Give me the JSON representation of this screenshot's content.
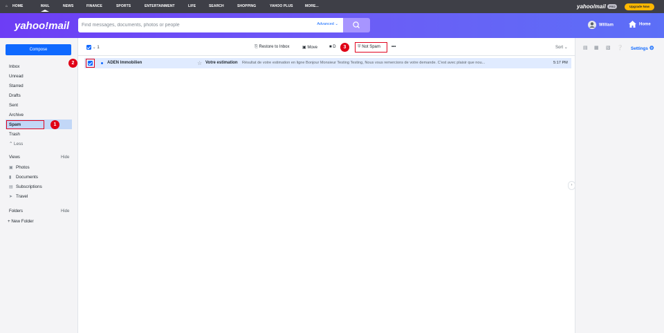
{
  "topnav": {
    "items": [
      "HOME",
      "MAIL",
      "NEWS",
      "FINANCE",
      "SPORTS",
      "ENTERTAINMENT",
      "LIFE",
      "SEARCH",
      "SHOPPING",
      "YAHOO PLUS",
      "MORE..."
    ],
    "brand": "yahoo/mail",
    "brand_tag": "PRO",
    "upgrade_label": "Upgrade Now"
  },
  "header": {
    "logo": "yahoo!mail",
    "search_placeholder": "Find messages, documents, photos or people",
    "advanced_label": "Advanced",
    "user_name": "William",
    "home_label": "Home"
  },
  "sidebar": {
    "compose_label": "Compose",
    "folders": [
      "Inbox",
      "Unread",
      "Starred",
      "Drafts",
      "Sent",
      "Archive",
      "Spam",
      "Trash"
    ],
    "less_label": "Less",
    "views_label": "Views",
    "views_hide": "Hide",
    "views": [
      "Photos",
      "Documents",
      "Subscriptions",
      "Travel"
    ],
    "folders_label": "Folders",
    "folders_hide": "Hide",
    "new_folder_label": "+ New Folder"
  },
  "toolbar": {
    "selected_count": "1",
    "restore_label": "Restore to Inbox",
    "move_label": "Move",
    "delete_label": "D",
    "not_spam_label": "Not Spam",
    "more_label": "•••",
    "sort_label": "Sort"
  },
  "message": {
    "sender": "ADEN Immobilien",
    "subject": "Votre estimation",
    "snippet": "Résultat de votre estimation en ligne Bonjour Monsieur Testing Testing, Nous vous remercions de votre demande. C'est avec plaisir que nou...",
    "time": "5:17 PM"
  },
  "rightpane": {
    "settings_label": "Settings"
  },
  "badges": [
    "1",
    "2",
    "3"
  ],
  "colors": {
    "accent": "#0f69ff",
    "highlight": "#e0001b",
    "header_gradient_start": "#6d3df5",
    "header_gradient_end": "#5c6ff7"
  }
}
